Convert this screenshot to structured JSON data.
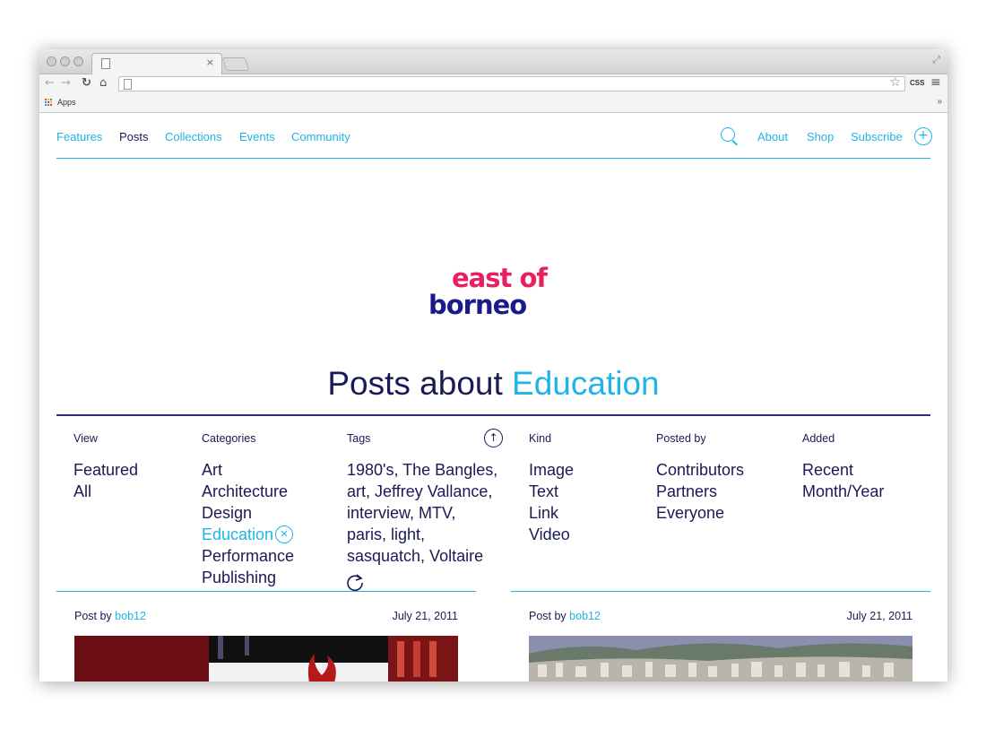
{
  "browser": {
    "tab_close": "×",
    "bookmarks": {
      "apps_label": "Apps",
      "overflow": "»"
    },
    "toolbar": {
      "css_label": "CSS"
    }
  },
  "nav": {
    "left": [
      "Features",
      "Posts",
      "Collections",
      "Events",
      "Community"
    ],
    "active": "Posts",
    "right": [
      "About",
      "Shop",
      "Subscribe"
    ]
  },
  "logo": {
    "line1": "east of",
    "line2": "borneo"
  },
  "heading": {
    "prefix": "Posts about",
    "highlight": "Education"
  },
  "filters": {
    "view": {
      "label": "View",
      "items": [
        "Featured",
        "All"
      ]
    },
    "categories": {
      "label": "Categories",
      "items": [
        "Art",
        "Architecture",
        "Design",
        "Education",
        "Performance",
        "Publishing"
      ],
      "selected": "Education"
    },
    "tags": {
      "label": "Tags",
      "text": "1980's, The Bangles, art, Jeffrey Vallance, interview, MTV, paris, light, sasquatch, Voltaire"
    },
    "kind": {
      "label": "Kind",
      "items": [
        "Image",
        "Text",
        "Link",
        "Video"
      ]
    },
    "posted_by": {
      "label": "Posted by",
      "items": [
        "Contributors",
        "Partners",
        "Everyone"
      ]
    },
    "added": {
      "label": "Added",
      "items": [
        "Recent",
        "Month/Year"
      ]
    }
  },
  "posts": [
    {
      "prefix": "Post by",
      "author": "bob12",
      "date": "July 21, 2011"
    },
    {
      "prefix": "Post by",
      "author": "bob12",
      "date": "July 21, 2011"
    }
  ],
  "colors": {
    "accent": "#1fb4e6",
    "navy": "#1a1a55",
    "logo_pink": "#e8205f",
    "logo_blue": "#1a1a8a"
  }
}
